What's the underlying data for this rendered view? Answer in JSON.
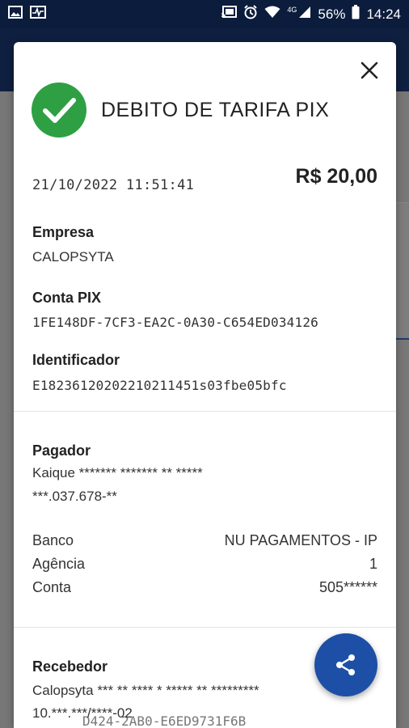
{
  "status_bar": {
    "signal_label": "4G",
    "battery": "56%",
    "time": "14:24",
    "icons": [
      "image-icon",
      "activity-icon",
      "cast-icon",
      "alarm-icon",
      "wifi-icon",
      "signal-icon",
      "battery-icon"
    ]
  },
  "receipt": {
    "title": "DEBITO DE TARIFA PIX",
    "datetime": "21/10/2022 11:51:41",
    "amount": "R$ 20,00",
    "empresa_label": "Empresa",
    "empresa_value": "CALOPSYTA",
    "conta_pix_label": "Conta PIX",
    "conta_pix_value": "1FE148DF-7CF3-EA2C-0A30-C654ED034126",
    "identificador_label": "Identificador",
    "identificador_value": "E18236120202210211451s03fbe05bfc",
    "pagador": {
      "label": "Pagador",
      "name": "Kaique ******* ******* ** *****",
      "document": "***.037.678-**",
      "banco_label": "Banco",
      "banco_value": "NU PAGAMENTOS - IP",
      "agencia_label": "Agência",
      "agencia_value": "1",
      "conta_label": "Conta",
      "conta_value": "505******"
    },
    "recebedor": {
      "label": "Recebedor",
      "name": "Calopsyta *** ** **** * ***** ** *********",
      "partial_line": "10.***.***/****-02",
      "ghost_text": "D424-2AB0-E6ED9731F6B"
    }
  },
  "colors": {
    "status_bar_bg": "#0c1c3c",
    "success_green": "#2ea043",
    "fab_blue": "#1e4fa6"
  }
}
